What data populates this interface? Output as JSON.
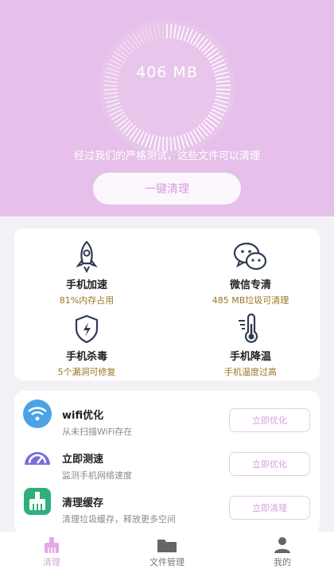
{
  "hero": {
    "size_value": "406 MB",
    "description": "经过我们的严格测试，这些文件可以清理",
    "clean_button": "一键清理"
  },
  "features": [
    {
      "title": "手机加速",
      "subtitle": "81%内存占用",
      "icon": "rocket-icon"
    },
    {
      "title": "微信专清",
      "subtitle": "485 MB垃圾可清理",
      "icon": "wechat-icon"
    },
    {
      "title": "手机杀毒",
      "subtitle": "5个漏洞可修复",
      "icon": "shield-icon"
    },
    {
      "title": "手机降温",
      "subtitle": "手机温度过高",
      "icon": "thermometer-icon"
    }
  ],
  "tools": [
    {
      "title": "wifi优化",
      "subtitle": "从未扫描WiFi存在",
      "button": "立即优化",
      "icon": "wifi-icon",
      "color": "#4aa3e6"
    },
    {
      "title": "立即测速",
      "subtitle": "监测手机网络速度",
      "button": "立即优化",
      "icon": "speedometer-icon",
      "color": "#7a6fd8"
    },
    {
      "title": "清理缓存",
      "subtitle": "清理垃圾缓存，释放更多空间",
      "button": "立即清理",
      "icon": "broom-icon",
      "color": "#2fb07a"
    }
  ],
  "tabs": [
    {
      "label": "清理",
      "icon": "broom-tab-icon",
      "active": true
    },
    {
      "label": "文件管理",
      "icon": "folder-icon",
      "active": false
    },
    {
      "label": "我的",
      "icon": "user-icon",
      "active": false
    }
  ],
  "colors": {
    "hero_bg": "#e6c0ea",
    "accent": "#d8a0de",
    "subtitle_gold": "#9a7623"
  }
}
